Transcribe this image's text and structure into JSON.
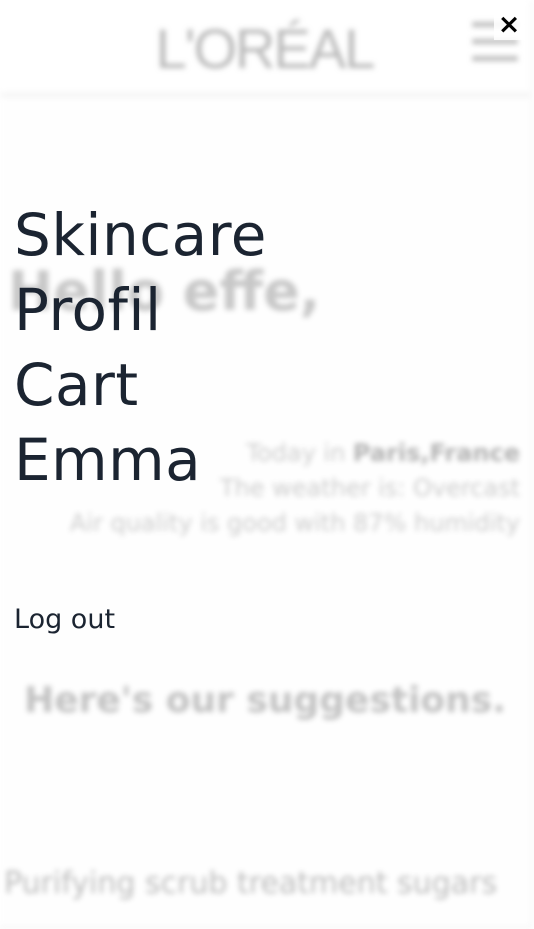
{
  "background_page": {
    "logo_text": "L'ORÉAL",
    "greeting": "Hello effe,",
    "weather": {
      "line1_prefix": "Today in ",
      "line1_location": "Paris,France",
      "line2": "The weather is: Overcast",
      "line3": "Air quality is good with 87% humidity"
    },
    "suggestions_heading": "Here's our suggestions.",
    "product_title": "Purifying scrub treatment sugars"
  },
  "menu": {
    "close_icon": "×",
    "items": [
      {
        "label": "Skincare"
      },
      {
        "label": "Profil"
      },
      {
        "label": "Cart"
      },
      {
        "label": "Emma"
      }
    ],
    "logout_label": "Log out"
  },
  "colors": {
    "menu_text": "#1b2431",
    "close_icon": "#000000"
  }
}
